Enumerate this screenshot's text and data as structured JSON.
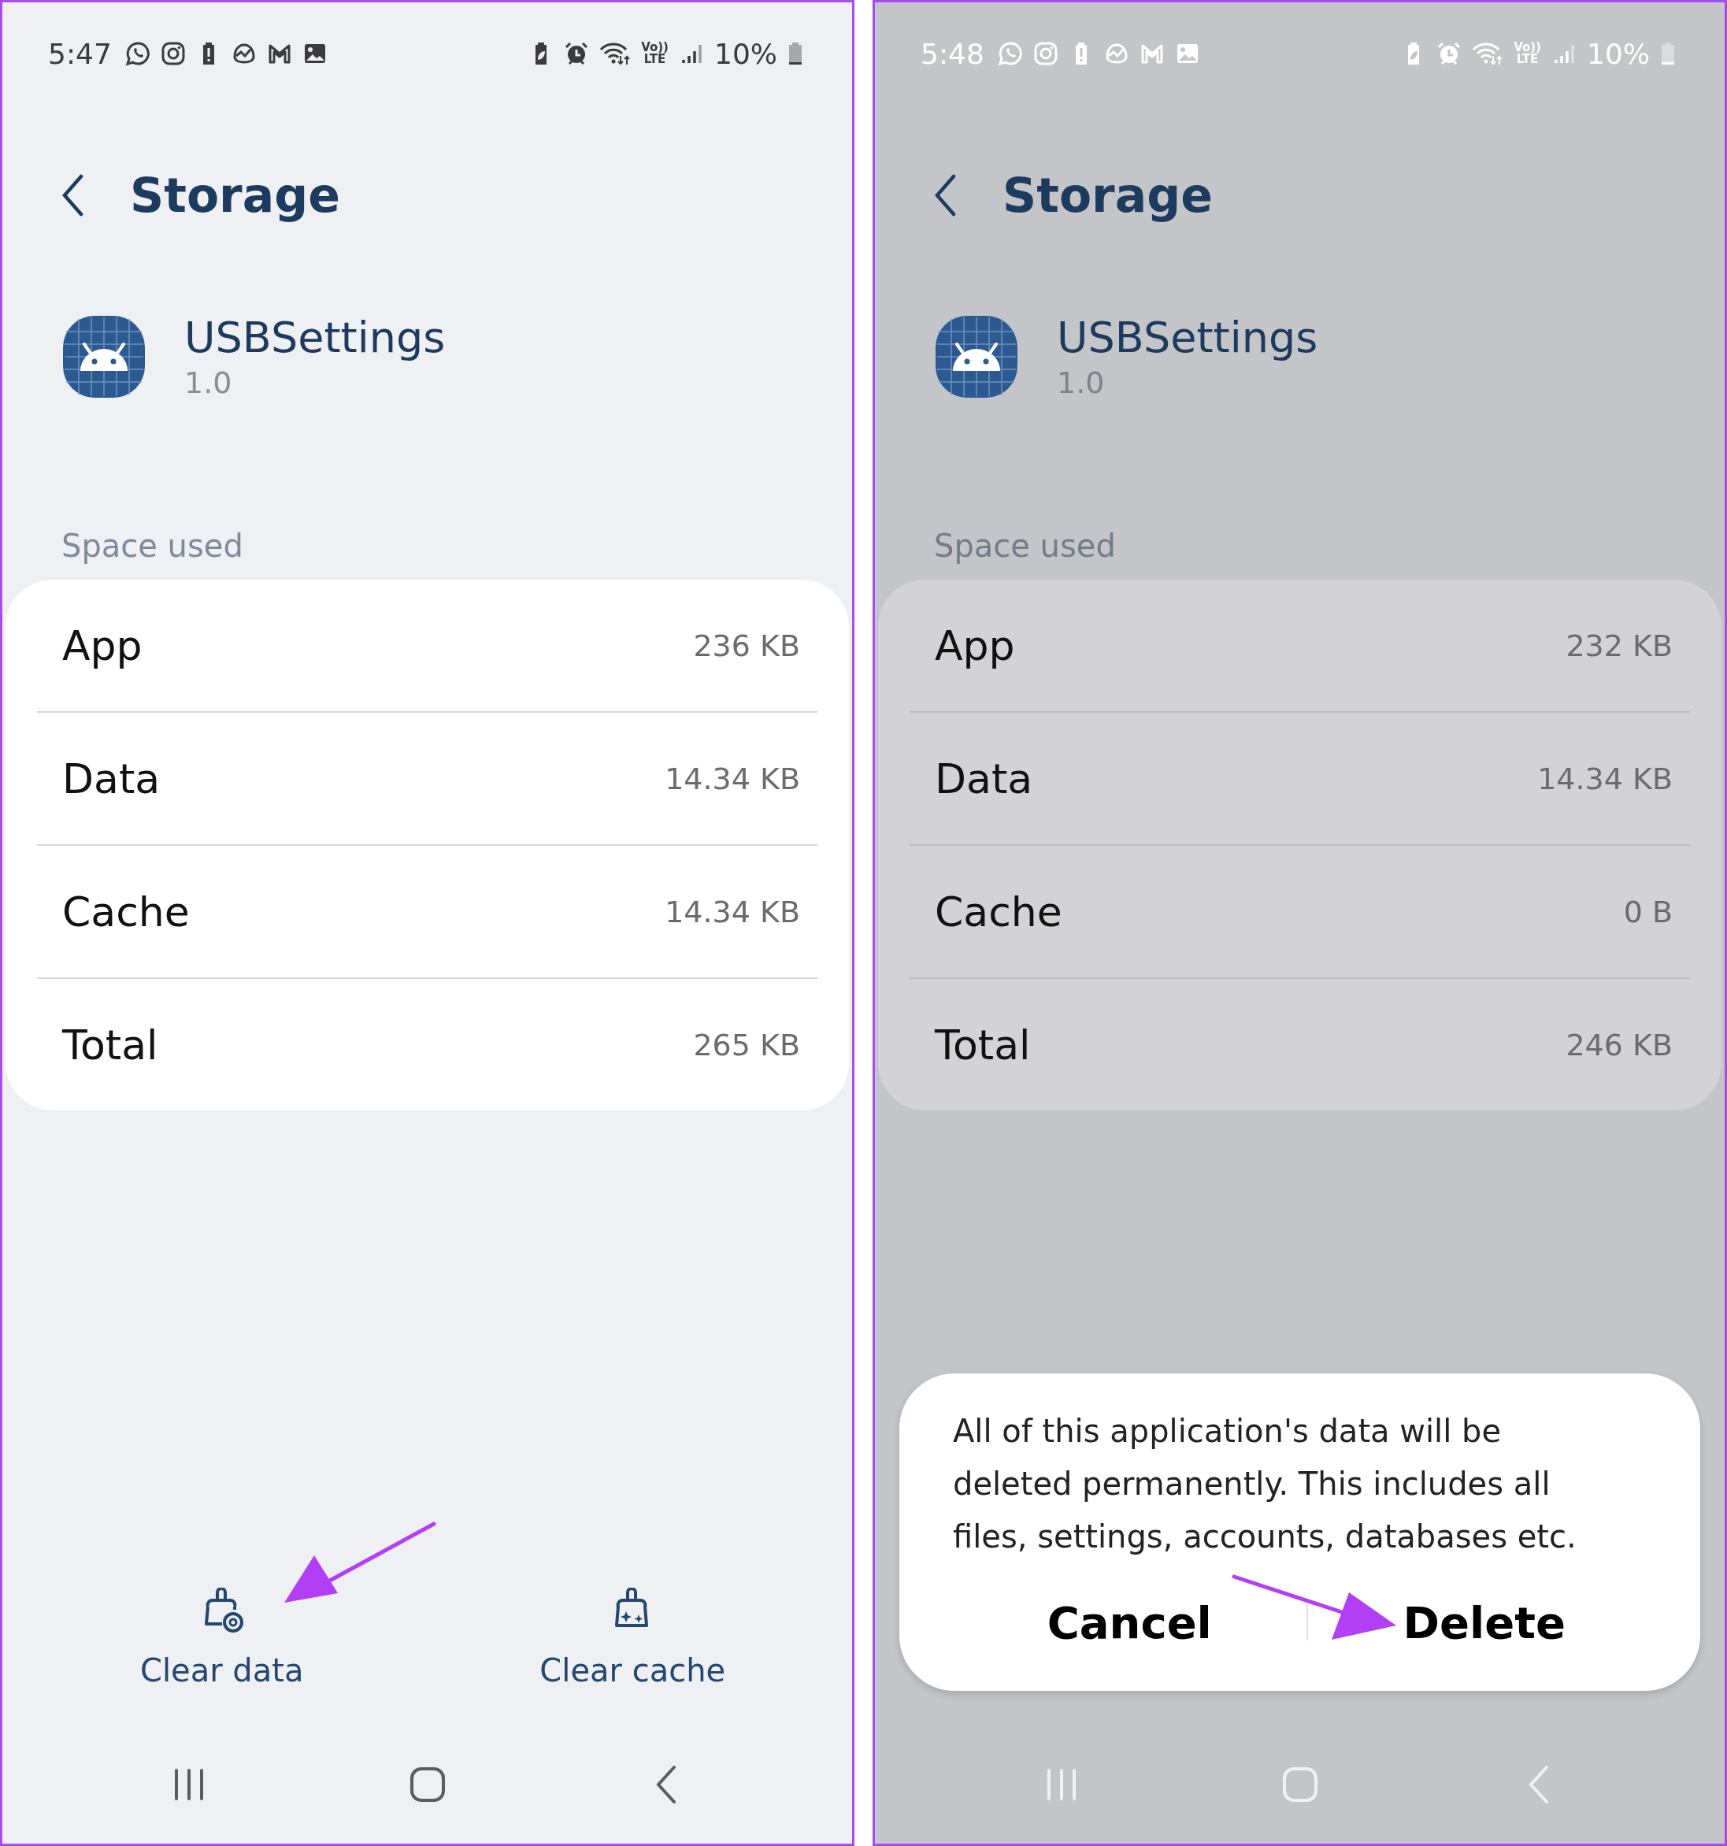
{
  "panels": [
    {
      "dimmed": false,
      "arrow": true,
      "status_bar": {
        "time": "5:47",
        "network": [
          "Vo))",
          "LTE"
        ],
        "battery": "10%"
      },
      "title": "Storage",
      "app": {
        "name": "USBSettings",
        "version": "1.0"
      },
      "section_label": "Space used",
      "rows": [
        {
          "label": "App",
          "value": "236 KB"
        },
        {
          "label": "Data",
          "value": "14.34 KB"
        },
        {
          "label": "Cache",
          "value": "14.34 KB"
        },
        {
          "label": "Total",
          "value": "265 KB"
        }
      ],
      "actions": [
        {
          "label": "Clear data",
          "kind": "data"
        },
        {
          "label": "Clear cache",
          "kind": "cache"
        }
      ]
    },
    {
      "dimmed": true,
      "arrow": true,
      "status_bar": {
        "time": "5:48",
        "network": [
          "Vo))",
          "LTE"
        ],
        "battery": "10%"
      },
      "title": "Storage",
      "app": {
        "name": "USBSettings",
        "version": "1.0"
      },
      "section_label": "Space used",
      "rows": [
        {
          "label": "App",
          "value": "232 KB"
        },
        {
          "label": "Data",
          "value": "14.34 KB"
        },
        {
          "label": "Cache",
          "value": "0 B"
        },
        {
          "label": "Total",
          "value": "246 KB"
        }
      ],
      "dialog": {
        "message": "All of this application's data will be deleted permanently. This includes all files, settings, accounts, databases etc.",
        "buttons": [
          {
            "label": "Cancel"
          },
          {
            "label": "Delete"
          }
        ]
      }
    }
  ]
}
